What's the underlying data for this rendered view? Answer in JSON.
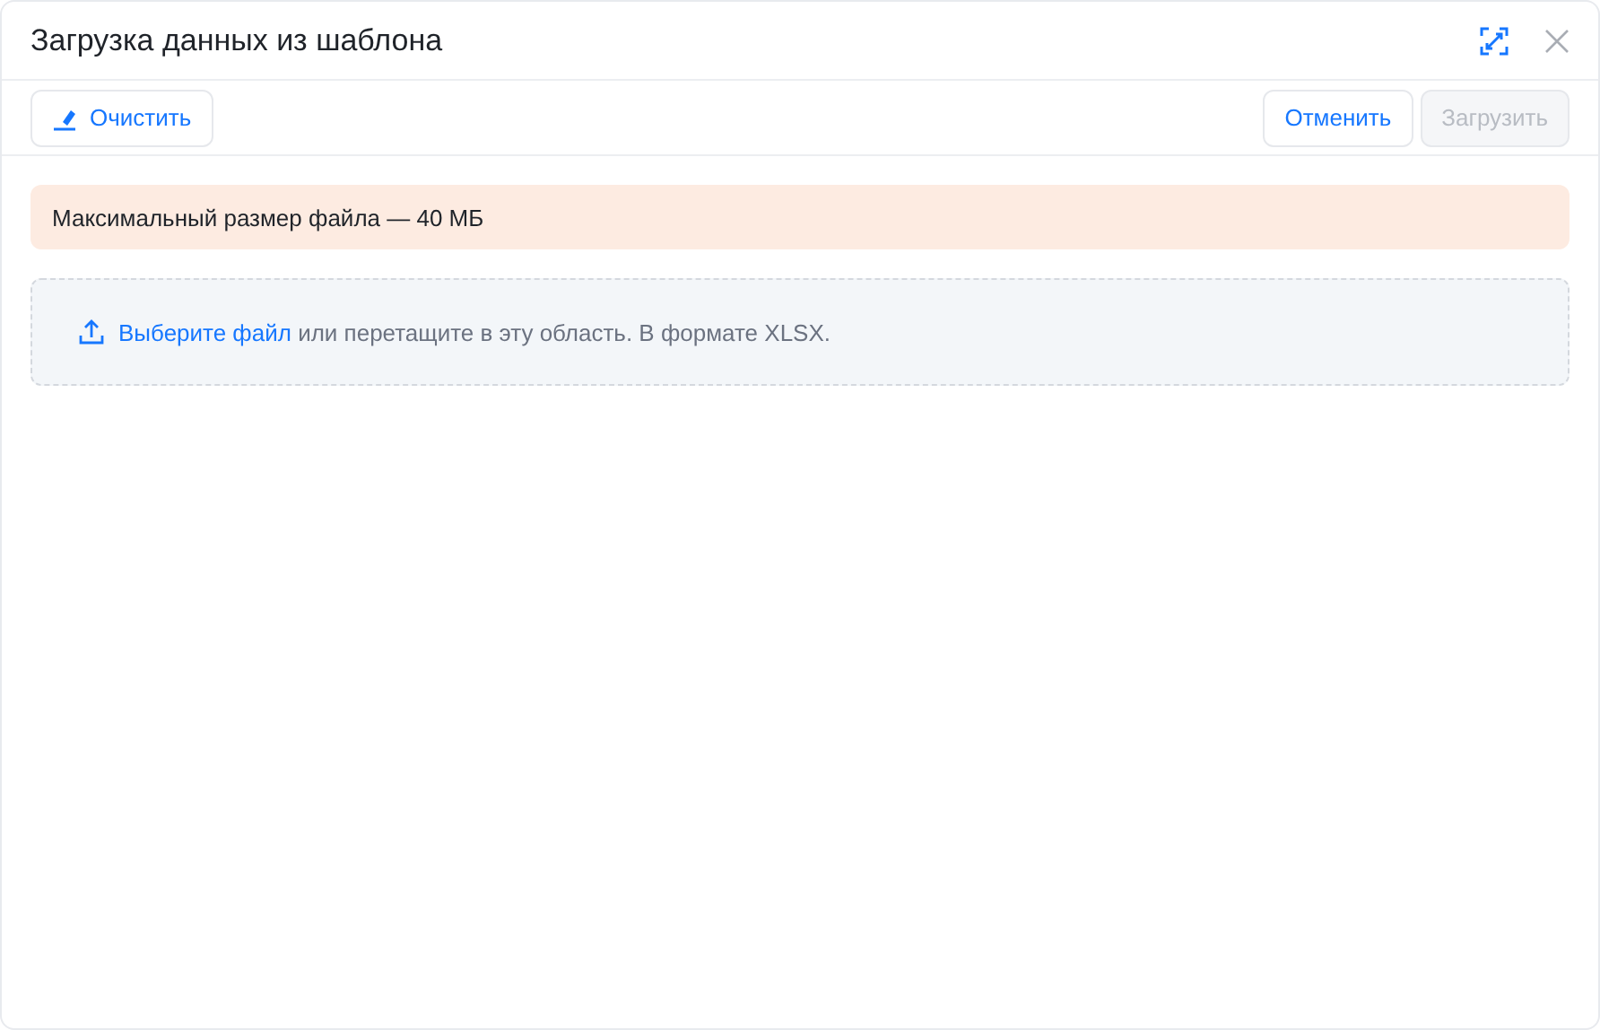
{
  "window": {
    "title": "Загрузка данных из шаблона"
  },
  "toolbar": {
    "left_buttons": [
      {
        "label": "Очистить",
        "disabled": false
      }
    ],
    "right_buttons": [
      {
        "label": "Отменить",
        "disabled": false
      },
      {
        "label": "Загрузить",
        "disabled": true
      }
    ]
  },
  "notice": "Максимальный размер файла — 40 МБ",
  "dropzone": {
    "link": "Выберите файл",
    "text": "или перетащите в эту область. В формате XLSX."
  }
}
